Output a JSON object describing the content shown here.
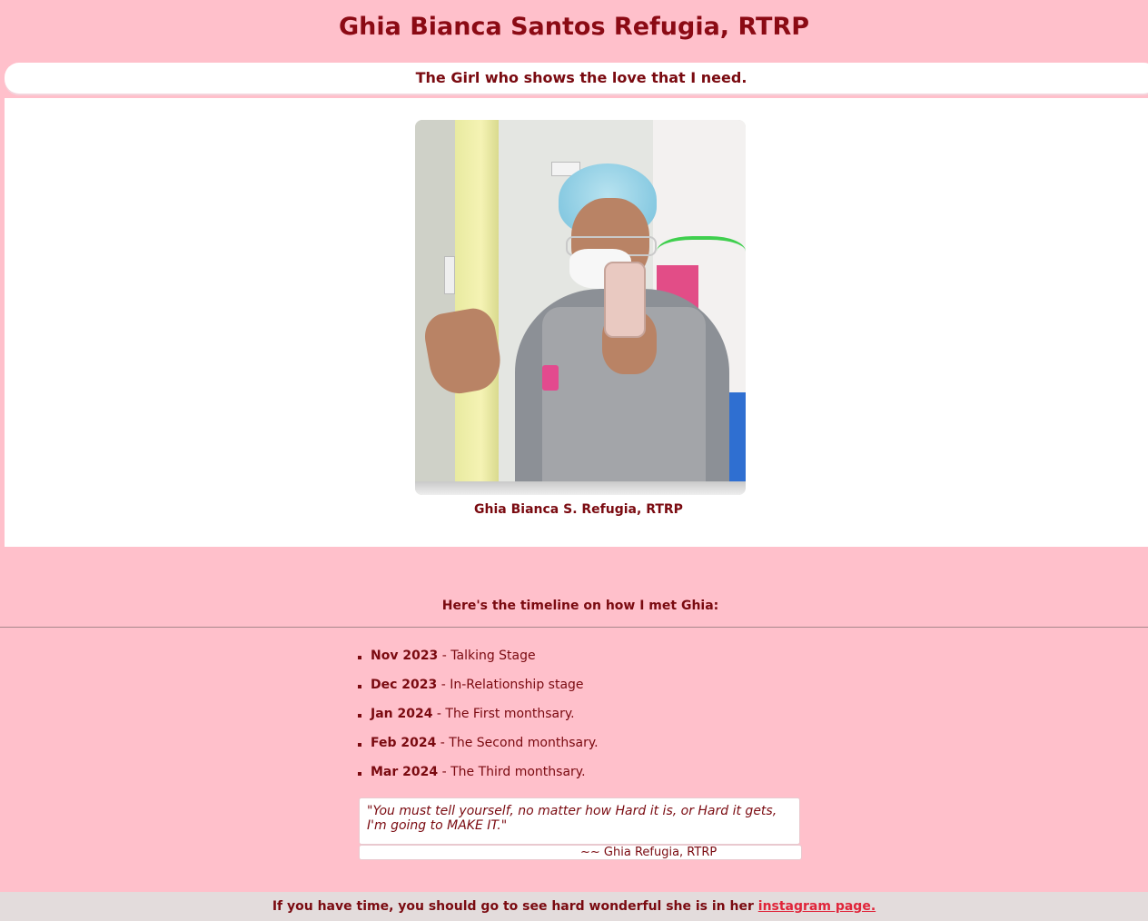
{
  "header": {
    "title": "Ghia Bianca Santos Refugia, RTRP",
    "tagline": "The Girl who shows the love that I need."
  },
  "photo": {
    "caption": "Ghia Bianca S. Refugia, RTRP"
  },
  "timeline": {
    "heading": "Here's the timeline on how I met Ghia:",
    "items": [
      {
        "date": "Nov 2023",
        "text": " - Talking Stage"
      },
      {
        "date": "Dec 2023",
        "text": " - In-Relationship stage"
      },
      {
        "date": "Jan 2024",
        "text": " - The First monthsary."
      },
      {
        "date": "Feb 2024",
        "text": " - The Second monthsary."
      },
      {
        "date": "Mar 2024",
        "text": " - The Third monthsary."
      }
    ]
  },
  "quote": {
    "text": "\"You must tell yourself, no matter how Hard it is, or Hard it gets, I'm going to MAKE IT.\"",
    "author": "~~ Ghia Refugia, RTRP"
  },
  "footer": {
    "text": "If you have time, you should go to see hard wonderful she is in her ",
    "link_label": "instagram page."
  }
}
